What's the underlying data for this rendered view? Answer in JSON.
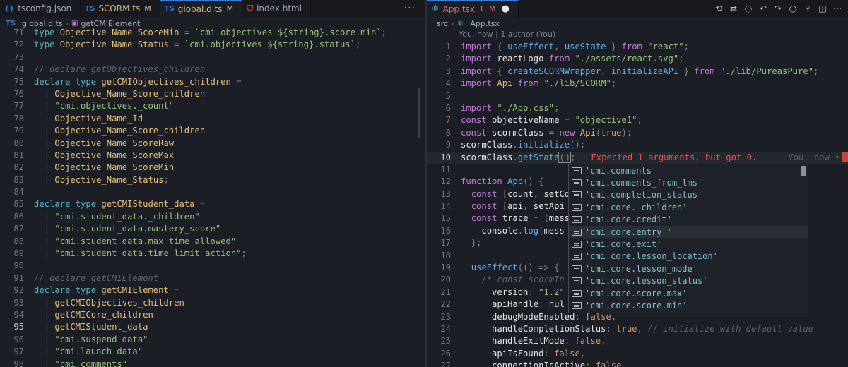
{
  "left": {
    "tabs": [
      {
        "label": "tsconfig.json",
        "icon": "ts-config-icon",
        "mod": ""
      },
      {
        "label": "SCORM.ts",
        "icon": "ts-icon",
        "mod": "M"
      },
      {
        "label": "global.d.ts",
        "icon": "ts-icon",
        "mod": "M"
      },
      {
        "label": "index.html",
        "icon": "html-icon",
        "mod": ""
      }
    ],
    "more_label": "···",
    "breadcrumb": [
      "global.d.ts",
      "getCMIElement"
    ],
    "lines": [
      {
        "n": "71",
        "t": "type Objective_Name_ScoreMin = `cmi.objectives_${string}.score.min`;"
      },
      {
        "n": "72",
        "t": "type Objective_Name_Status = `cmi.objectives_${string}.status`;"
      },
      {
        "n": "73",
        "t": ""
      },
      {
        "n": "74",
        "t": "// declare getObjectives_children"
      },
      {
        "n": "75",
        "t": "declare type getCMIObjectives_children ="
      },
      {
        "n": "76",
        "t": "  | Objective_Name_Score_children"
      },
      {
        "n": "77",
        "t": "  | \"cmi.objectives._count\""
      },
      {
        "n": "78",
        "t": "  | Objective_Name_Id"
      },
      {
        "n": "79",
        "t": "  | Objective_Name_Score_children"
      },
      {
        "n": "80",
        "t": "  | Objective_Name_ScoreRaw"
      },
      {
        "n": "81",
        "t": "  | Objective_Name_ScoreMax"
      },
      {
        "n": "82",
        "t": "  | Objective_Name_ScoreMin"
      },
      {
        "n": "83",
        "t": "  | Objective_Name_Status;"
      },
      {
        "n": "84",
        "t": ""
      },
      {
        "n": "85",
        "t": "declare type getCMIStudent_data ="
      },
      {
        "n": "86",
        "t": "  | \"cmi.student_data._children\""
      },
      {
        "n": "87",
        "t": "  | \"cmi.student_data.mastery_score\""
      },
      {
        "n": "88",
        "t": "  | \"cmi.student_data.max_time_allowed\""
      },
      {
        "n": "89",
        "t": "  | \"cmi.student_data.time_limit_action\";"
      },
      {
        "n": "90",
        "t": ""
      },
      {
        "n": "91",
        "t": "// declare getCMIElement"
      },
      {
        "n": "92",
        "t": "declare type getCMIElement ="
      },
      {
        "n": "93",
        "t": "  | getCMIObjectives_children"
      },
      {
        "n": "94",
        "t": "  | getCMICore_children"
      },
      {
        "n": "95",
        "t": "  | getCMIStudent_data"
      },
      {
        "n": "96",
        "t": "  | \"cmi.suspend_data\""
      },
      {
        "n": "97",
        "t": "  | \"cmi.launch_data\""
      },
      {
        "n": "98",
        "t": "  | \"cmi.comments\""
      }
    ],
    "current_line": "95"
  },
  "right": {
    "tab": {
      "label": "App.tsx",
      "mod": "1, M"
    },
    "breadcrumb": [
      "src",
      "App.tsx"
    ],
    "author": "You, now | 1 author (You)",
    "actions": [
      "history-icon",
      "git-compare-icon",
      "comment-icon",
      "go-back-icon",
      "go-forward-icon",
      "circle-icon",
      "git-branch-icon",
      "split-editor-icon",
      "more-icon"
    ],
    "lines": [
      {
        "n": "1",
        "t": "import { useEffect, useState } from \"react\";"
      },
      {
        "n": "2",
        "t": "import reactLogo from \"./assets/react.svg\";"
      },
      {
        "n": "3",
        "t": "import { createSCORMWrapper, initializeAPI } from \"./lib/PureasPure\";"
      },
      {
        "n": "4",
        "t": "import Api from \"./lib/SCORM\";"
      },
      {
        "n": "5",
        "t": ""
      },
      {
        "n": "6",
        "t": "import \"./App.css\";"
      },
      {
        "n": "7",
        "t": "const objectiveName = \"objective1\";"
      },
      {
        "n": "8",
        "t": "const scormClass = new Api(true);"
      },
      {
        "n": "9",
        "t": "scormClass.initialize();"
      },
      {
        "n": "10",
        "t": "scormClass.getState();"
      },
      {
        "n": "11",
        "t": ""
      },
      {
        "n": "12",
        "t": "function App() {"
      },
      {
        "n": "13",
        "t": "  const [count, setCo"
      },
      {
        "n": "14",
        "t": "  const [api, setApi"
      },
      {
        "n": "15",
        "t": "  const trace = (mess"
      },
      {
        "n": "16",
        "t": "    console.log(mess"
      },
      {
        "n": "17",
        "t": "  };"
      },
      {
        "n": "18",
        "t": ""
      },
      {
        "n": "19",
        "t": "  useEffect(() => {"
      },
      {
        "n": "20",
        "t": "    /* const scormIn"
      },
      {
        "n": "21",
        "t": "      version: \"1.2\""
      },
      {
        "n": "22",
        "t": "      apiHandle: nul"
      },
      {
        "n": "23",
        "t": "      debugModeEnabled: false,"
      },
      {
        "n": "24",
        "t": "      handleCompletionStatus: true, // initialize with default value"
      },
      {
        "n": "25",
        "t": "      handleExitMode: false,"
      },
      {
        "n": "26",
        "t": "      apiIsFound: false,"
      },
      {
        "n": "27",
        "t": "      connectionIsActive: false,"
      }
    ],
    "error_message": "Expected 1 arguments, but got 0.",
    "blame": "You, now • Un",
    "suggestions": [
      "'cmi.comments'",
      "'cmi.comments_from_lms'",
      "'cmi.completion_status'",
      "'cmi.core._children'",
      "'cmi.core.credit'",
      "'cmi.core.entry '",
      "'cmi.core.exit'",
      "'cmi.core.lesson_location'",
      "'cmi.core.lesson_mode'",
      "'cmi.core.lesson_status'",
      "'cmi.core.score.max'",
      "'cmi.core.score.min'"
    ],
    "selected_suggestion": 5
  }
}
